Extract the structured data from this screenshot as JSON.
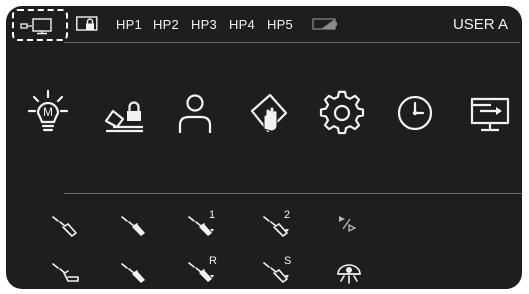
{
  "topbar": {
    "hp_tabs": [
      {
        "id": "hp1",
        "label": "HP1"
      },
      {
        "id": "hp2",
        "label": "HP2"
      },
      {
        "id": "hp3",
        "label": "HP3"
      },
      {
        "id": "hp4",
        "label": "HP4"
      },
      {
        "id": "hp5",
        "label": "HP5"
      }
    ],
    "user_label": "USER A",
    "icons": [
      "display-mode-icon",
      "lock-screen-icon",
      "battery-icon"
    ]
  },
  "main_icons": [
    "maintenance-light-icon",
    "locked-instrument-icon",
    "user-profile-icon",
    "hygiene-touch-icon",
    "settings-icon",
    "clock-icon",
    "screen-output-icon"
  ],
  "row1": {
    "icons": [
      "instrument-1-icon",
      "instrument-2-icon",
      "instrument-3-icon",
      "instrument-4-icon",
      "play-step-icon"
    ],
    "labels": {
      "instrument_3": "1",
      "instrument_4": "2"
    }
  },
  "row2": {
    "icons": [
      "instrument-5-icon",
      "instrument-6-icon",
      "instrument-7-icon",
      "instrument-8-icon",
      "operating-light-icon"
    ],
    "labels": {
      "instrument_7": "R",
      "instrument_8": "S"
    }
  },
  "colors": {
    "screen": "#1e1e1e",
    "foreground": "#f2f2f2",
    "divider": "#6a6a6a"
  }
}
